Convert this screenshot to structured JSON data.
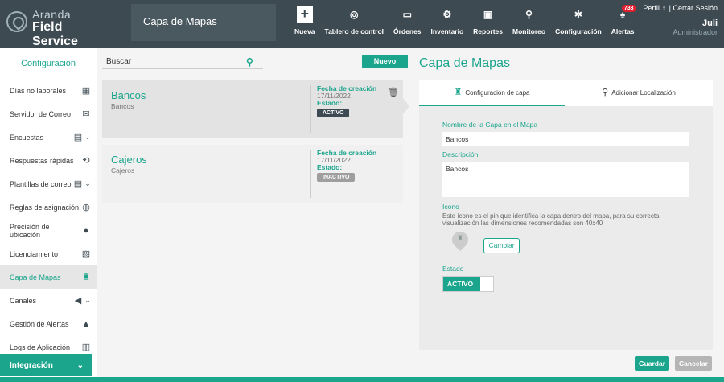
{
  "brand": {
    "line1": "Aranda",
    "line2": "Field Service"
  },
  "module_title": "Capa de Mapas",
  "nav": [
    {
      "label": "Nueva",
      "icon": "plus-icon"
    },
    {
      "label": "Tablero de control",
      "icon": "dashboard-icon"
    },
    {
      "label": "Órdenes",
      "icon": "orders-icon"
    },
    {
      "label": "Inventario",
      "icon": "inventory-icon"
    },
    {
      "label": "Reportes",
      "icon": "reports-icon"
    },
    {
      "label": "Monitoreo",
      "icon": "monitoring-icon"
    },
    {
      "label": "Configuración",
      "icon": "gear-icon"
    },
    {
      "label": "Alertas",
      "icon": "bell-icon",
      "badge": "733"
    }
  ],
  "user": {
    "perfil": "Perfil",
    "separator": "|",
    "logout": "Cerrar Sesión",
    "name": "Juli",
    "role": "Administrador"
  },
  "sidebar": {
    "title": "Configuración",
    "items": [
      {
        "label": "Días no laborales",
        "icon": "calendar-icon"
      },
      {
        "label": "Servidor de Correo",
        "icon": "mail-icon"
      },
      {
        "label": "Encuestas",
        "icon": "survey-icon",
        "chevron": true
      },
      {
        "label": "Respuestas rápidas",
        "icon": "quick-reply-icon"
      },
      {
        "label": "Plantillas de correo",
        "icon": "mail-template-icon",
        "chevron": true
      },
      {
        "label": "Reglas de asignación",
        "icon": "rules-icon"
      },
      {
        "label": "Precisión de ubicación",
        "icon": "location-icon"
      },
      {
        "label": "Licenciamiento",
        "icon": "license-icon"
      },
      {
        "label": "Capa de Mapas",
        "icon": "map-layer-icon",
        "active": true
      },
      {
        "label": "Canales",
        "icon": "megaphone-icon",
        "chevron": true
      },
      {
        "label": "Gestión de Alertas",
        "icon": "bell-icon"
      },
      {
        "label": "Logs de Aplicación",
        "icon": "logs-icon"
      }
    ],
    "integration": "Integración"
  },
  "list": {
    "search_placeholder": "Buscar",
    "new_label": "Nuevo",
    "cards": [
      {
        "title": "Bancos",
        "subtitle": "Bancos",
        "created_label": "Fecha de creación",
        "created": "17/11/2022",
        "state_label": "Estado:",
        "state": "ACTIVO",
        "state_color": "#3d4a52"
      },
      {
        "title": "Cajeros",
        "subtitle": "Cajeros",
        "created_label": "Fecha de creación",
        "created": "17/11/2022",
        "state_label": "Estado:",
        "state": "INACTIVO",
        "state_color": "#9e9e9e"
      }
    ]
  },
  "detail": {
    "title": "Capa de Mapas",
    "tab_config": "Configuración de capa",
    "tab_location": "Adicionar Localización",
    "name_label": "Nombre de la Capa en el Mapa",
    "name_value": "Bancos",
    "desc_label": "Descripción",
    "desc_value": "Bancos",
    "icon_label": "Icono",
    "icon_help": "Este ícono es el pin que identifica la capa dentro del mapa, para su correcta visualización las dimensiones recomendadas son 40x40",
    "change_label": "Cambiar",
    "state_label": "Estado",
    "state_value": "ACTIVO"
  },
  "actions": {
    "save": "Guardar",
    "cancel": "Cancelar"
  },
  "colors": {
    "accent": "#1ca58d",
    "topbar": "#3d4a52",
    "alert": "#e02030"
  }
}
